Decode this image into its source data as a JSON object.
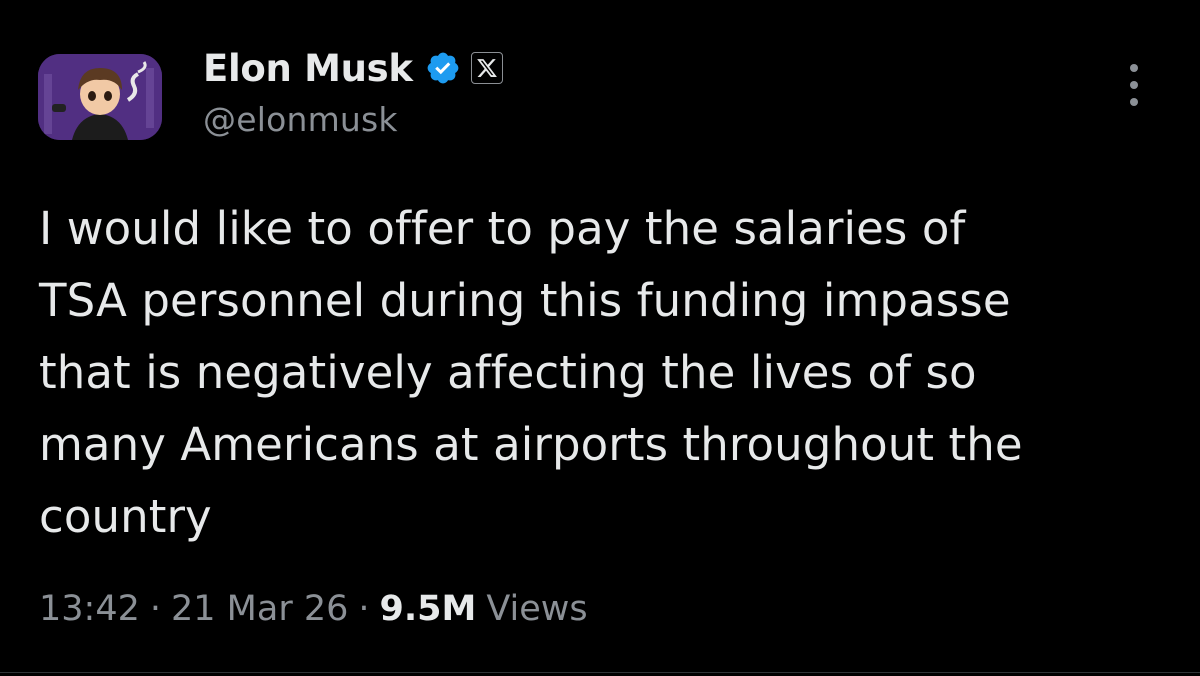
{
  "author": {
    "display_name": "Elon Musk",
    "handle": "@elonmusk",
    "avatar_icon": "profile-avatar",
    "verified_icon": "verified-badge-icon",
    "affiliation_icon": "x-logo-icon"
  },
  "tweet": {
    "text": "I would like to offer to pay the salaries of\nTSA personnel during this funding impasse\nthat is negatively affecting the lives of so\nmany Americans at airports throughout the\ncountry"
  },
  "meta": {
    "time": "13:42",
    "date": "21 Mar 26",
    "views_count": "9.5M",
    "views_label": "Views",
    "separator": "·"
  },
  "actions": {
    "more_icon": "more-options-icon"
  },
  "colors": {
    "background": "#000000",
    "primary_text": "#e7e9ea",
    "secondary_text": "#8b9096",
    "verified_blue": "#1d9bf0"
  }
}
